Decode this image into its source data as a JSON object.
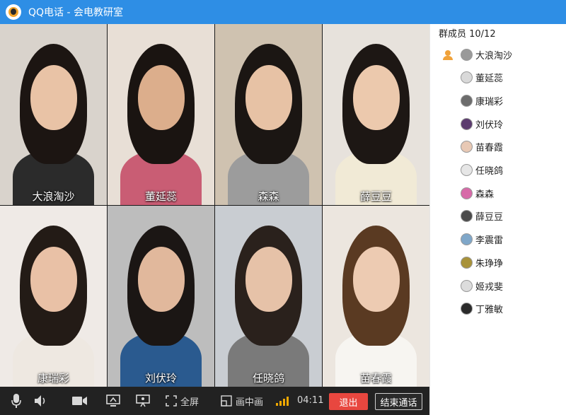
{
  "window": {
    "title": "QQ电话 - 会电教研室"
  },
  "participants_panel": {
    "header": "群成员 10/12",
    "members": [
      {
        "name": "大浪淘沙",
        "host": true,
        "avatar_color": "#9a9a9a"
      },
      {
        "name": "董延蕊",
        "host": false,
        "avatar_color": "#d9d9d9"
      },
      {
        "name": "康瑞彩",
        "host": false,
        "avatar_color": "#6c6c6c"
      },
      {
        "name": "刘伏玲",
        "host": false,
        "avatar_color": "#5b3b6e"
      },
      {
        "name": "苗春霞",
        "host": false,
        "avatar_color": "#e8c9b5"
      },
      {
        "name": "任晓鸽",
        "host": false,
        "avatar_color": "#e6e6e6"
      },
      {
        "name": "森森",
        "host": false,
        "avatar_color": "#d76aa8"
      },
      {
        "name": "薛豆豆",
        "host": false,
        "avatar_color": "#4a4a4a"
      },
      {
        "name": "李震雷",
        "host": false,
        "avatar_color": "#7fa7c9"
      },
      {
        "name": "朱琤琤",
        "host": false,
        "avatar_color": "#a8923a"
      },
      {
        "name": "姬戎斐",
        "host": false,
        "avatar_color": "#dcdcdc"
      },
      {
        "name": "丁雅敏",
        "host": false,
        "avatar_color": "#2b2b2b"
      }
    ]
  },
  "video_tiles": [
    {
      "name": "大浪淘沙",
      "bg": "#d9d3cc",
      "hair": "#1c1512",
      "skin": "#e9c3a6",
      "shirt": "#2b2b2b"
    },
    {
      "name": "董延蕊",
      "bg": "#e8dfd6",
      "hair": "#1a1411",
      "skin": "#dcae8c",
      "shirt": "#c95d74"
    },
    {
      "name": "森森",
      "bg": "#cfc2b0",
      "hair": "#1b1613",
      "skin": "#e7c2a5",
      "shirt": "#9c9c9c"
    },
    {
      "name": "薛豆豆",
      "bg": "#e7e2dc",
      "hair": "#1d1714",
      "skin": "#ecc9ad",
      "shirt": "#f1ead6"
    },
    {
      "name": "康瑞彩",
      "bg": "#efeae6",
      "hair": "#231b16",
      "skin": "#e9c1a6",
      "shirt": "#eee8e1"
    },
    {
      "name": "刘伏玲",
      "bg": "#bdbdbd",
      "hair": "#1b1614",
      "skin": "#e1b89c",
      "shirt": "#2a5a8f"
    },
    {
      "name": "任晓鸽",
      "bg": "#c9cdd2",
      "hair": "#2a211c",
      "skin": "#e6c2a8",
      "shirt": "#7a7a7a"
    },
    {
      "name": "苗春霞",
      "bg": "#ece6df",
      "hair": "#5a3a22",
      "skin": "#edcbb2",
      "shirt": "#f7f5f1"
    }
  ],
  "toolbar": {
    "fullscreen_label": "全屏",
    "pip_label": "画中画",
    "call_duration": "04:11",
    "exit_label": "退出",
    "end_call_label": "结束通话"
  },
  "colors": {
    "titlebar": "#2e8ee5",
    "exit_button": "#e8473f",
    "signal": "#f0a800"
  }
}
